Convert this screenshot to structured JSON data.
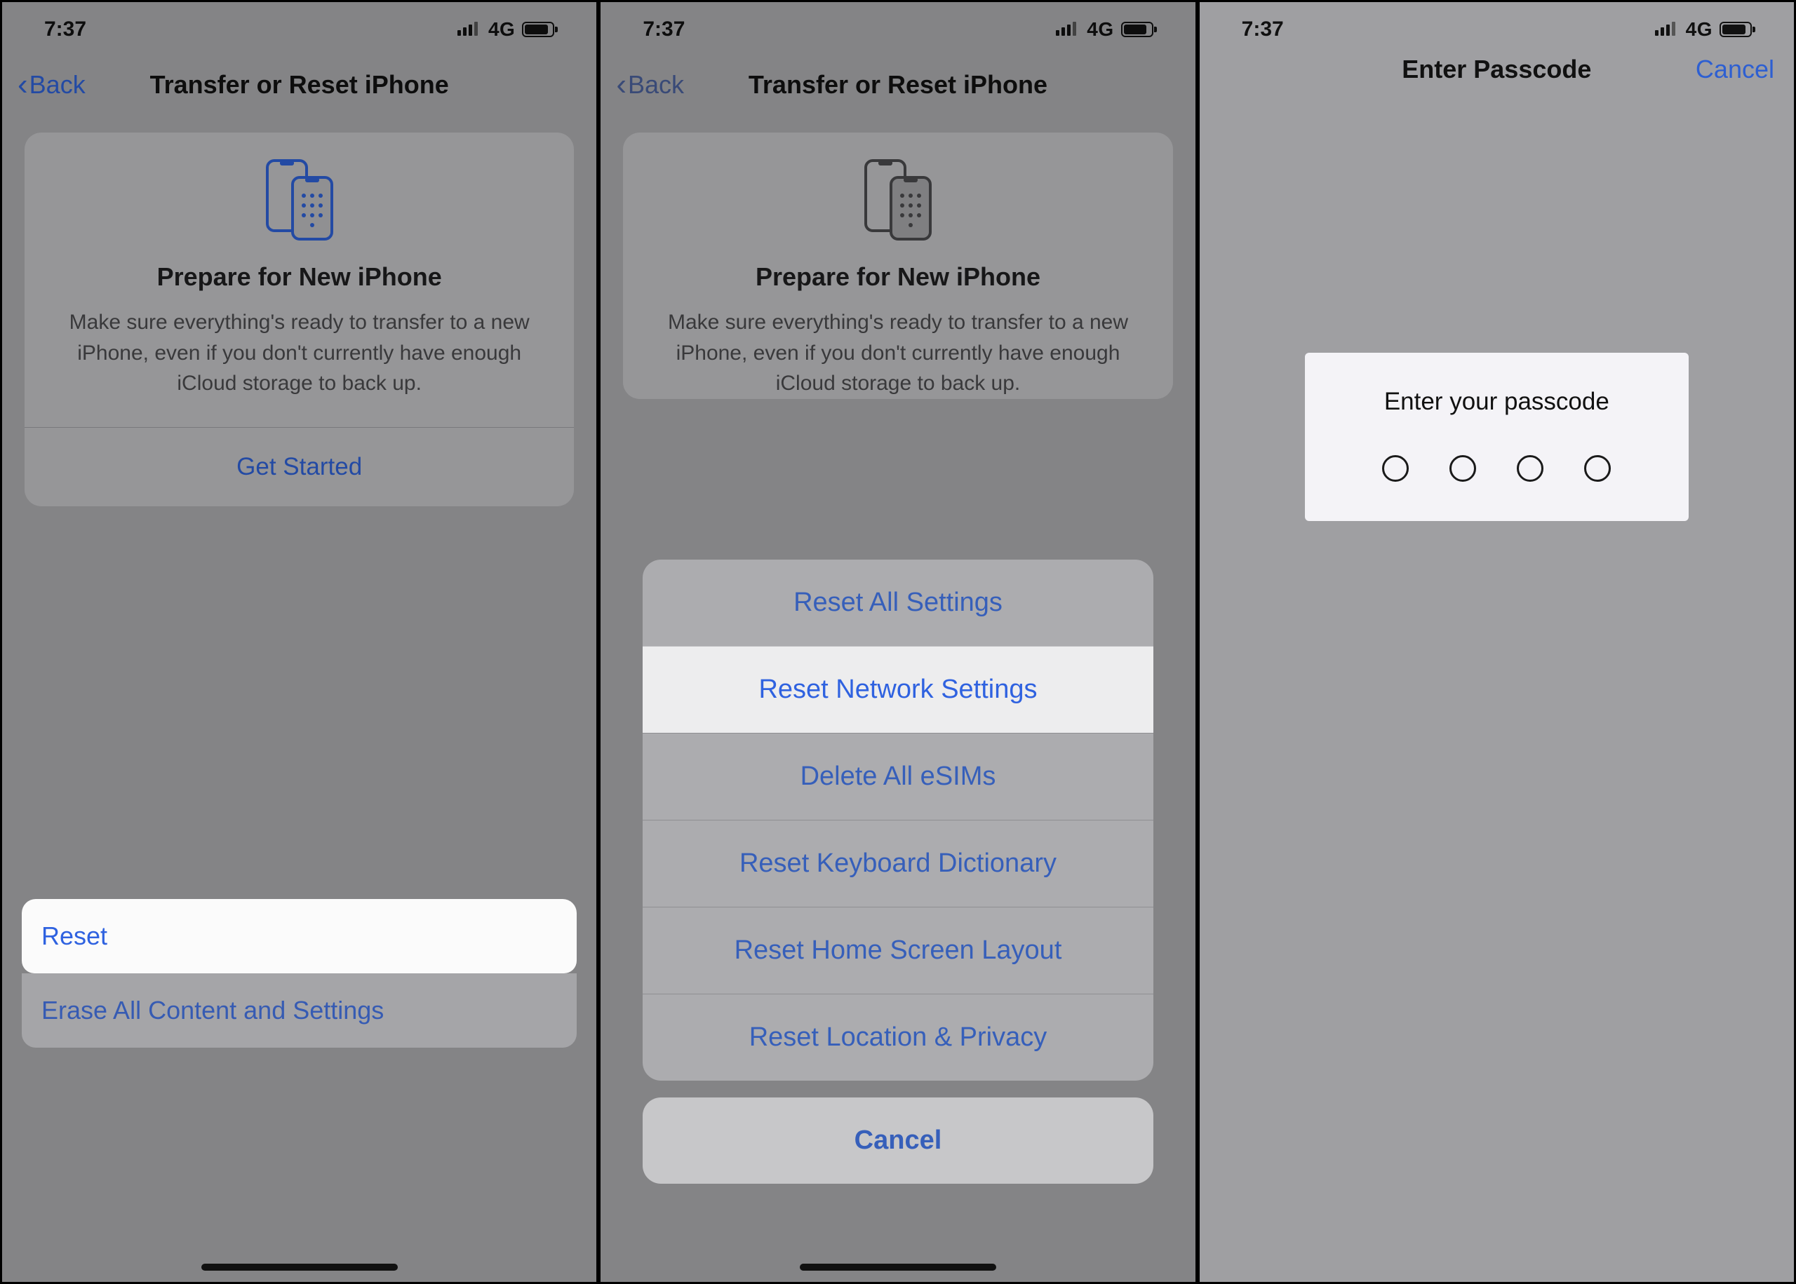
{
  "status": {
    "time": "7:37",
    "net": "4G"
  },
  "nav": {
    "back": "Back",
    "title": "Transfer or Reset iPhone",
    "cancel": "Cancel"
  },
  "prepare": {
    "title": "Prepare for New iPhone",
    "desc": "Make sure everything's ready to transfer to a new iPhone, even if you don't currently have enough iCloud storage to back up.",
    "cta": "Get Started"
  },
  "list": {
    "reset": "Reset",
    "erase": "Erase All Content and Settings"
  },
  "sheet": {
    "reset_all": "Reset All Settings",
    "reset_network": "Reset Network Settings",
    "delete_esims": "Delete All eSIMs",
    "reset_keyboard": "Reset Keyboard Dictionary",
    "reset_home": "Reset Home Screen Layout",
    "reset_location": "Reset Location & Privacy",
    "cancel": "Cancel"
  },
  "passcode": {
    "header": "Enter Passcode",
    "prompt": "Enter your passcode"
  }
}
